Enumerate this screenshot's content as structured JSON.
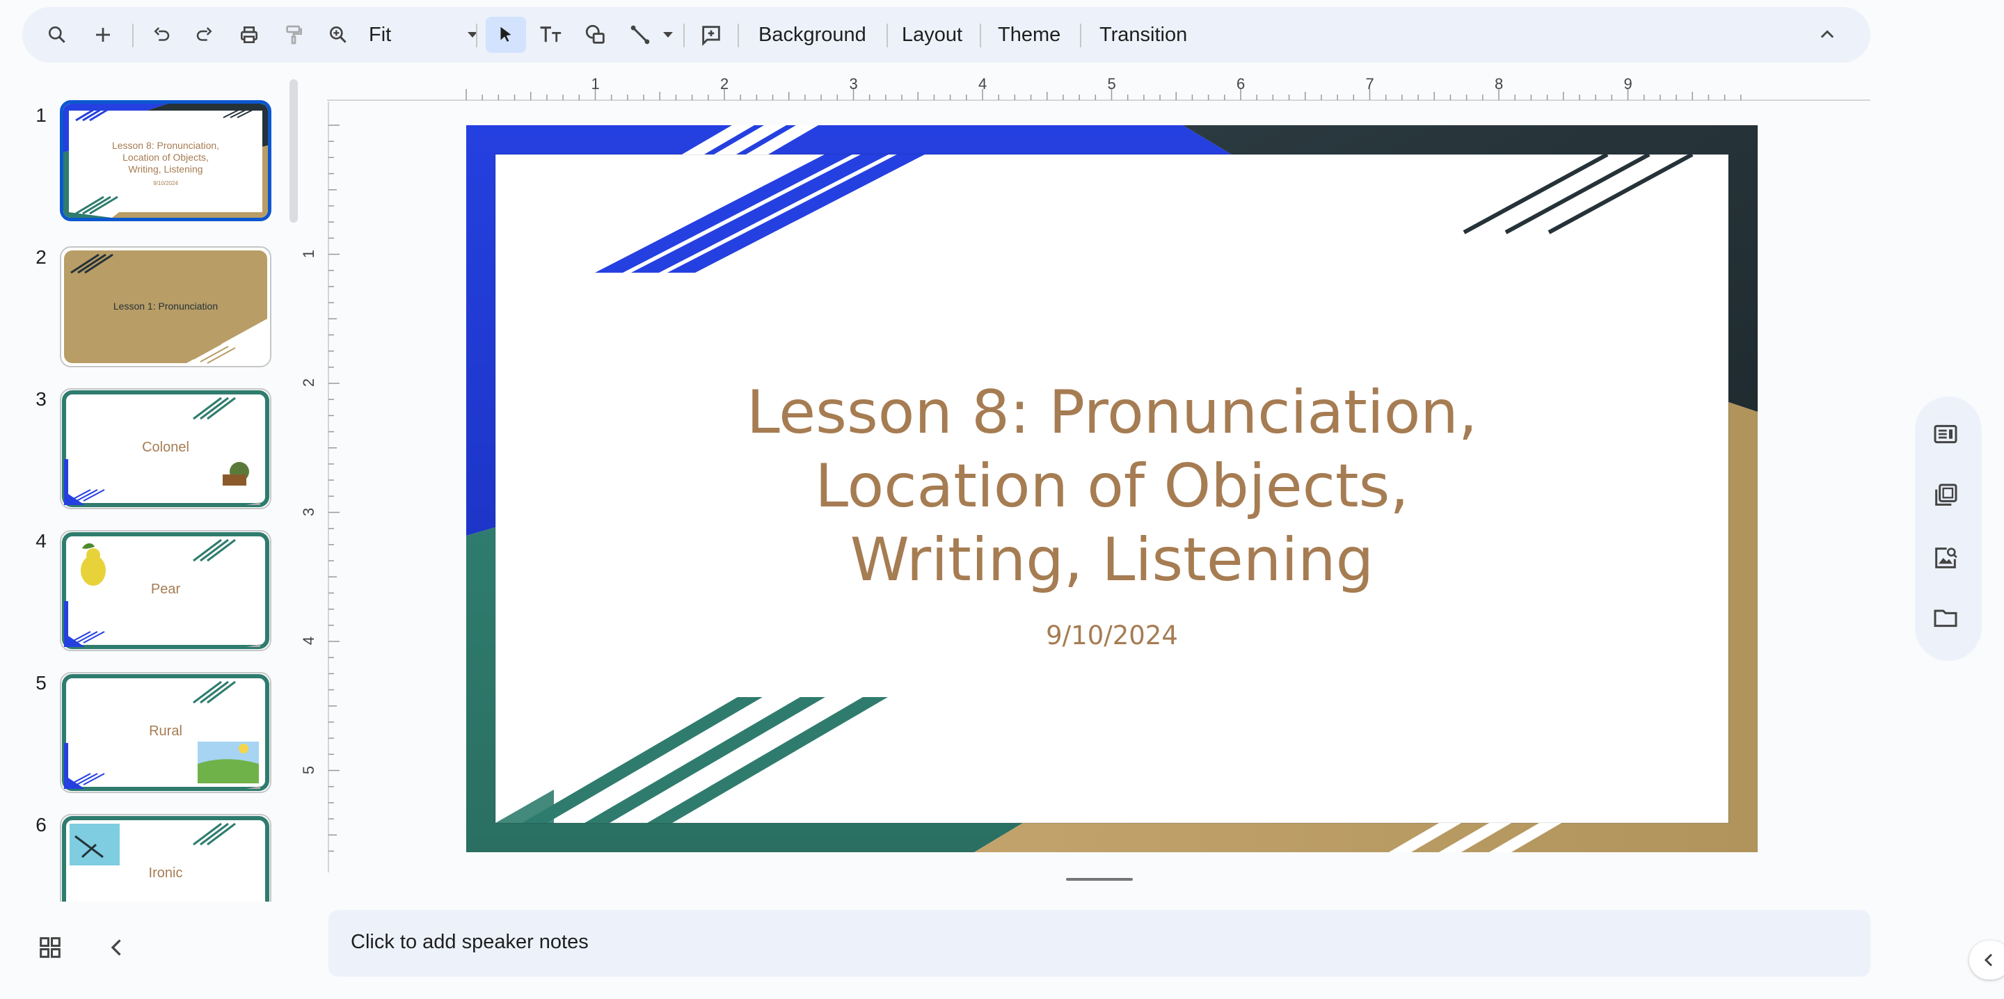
{
  "toolbar": {
    "zoom_value": "Fit",
    "background_label": "Background",
    "layout_label": "Layout",
    "theme_label": "Theme",
    "transition_label": "Transition",
    "icons": [
      "search-icon",
      "add-icon",
      "undo-icon",
      "redo-icon",
      "print-icon",
      "paint-format-icon",
      "zoom-icon",
      "select-icon",
      "text-box-icon",
      "shape-icon",
      "line-icon",
      "comment-icon",
      "collapse-icon"
    ]
  },
  "filmstrip": {
    "slides": [
      {
        "number": "1",
        "title": "Lesson 8: Pronunciation, Location of Objects, Writing, Listening",
        "subtitle": "9/10/2024"
      },
      {
        "number": "2",
        "title": "Lesson 1: Pronunciation"
      },
      {
        "number": "3",
        "title": "Colonel"
      },
      {
        "number": "4",
        "title": "Pear"
      },
      {
        "number": "5",
        "title": "Rural"
      },
      {
        "number": "6",
        "title": "Ironic"
      }
    ]
  },
  "ruler": {
    "horizontal": [
      "1",
      "2",
      "3",
      "4",
      "5",
      "6",
      "7",
      "8",
      "9"
    ],
    "vertical": [
      "1",
      "2",
      "3",
      "4",
      "5"
    ]
  },
  "slide": {
    "title_line1": "Lesson 8: Pronunciation,",
    "title_line2": "Location of Objects,",
    "title_line3": "Writing, Listening",
    "date": "9/10/2024",
    "colors": {
      "blue": "#2540e0",
      "dark": "#253238",
      "green": "#2f7c6e",
      "tan": "#b89d66",
      "title": "#a67c52"
    }
  },
  "notes": {
    "placeholder": "Click to add speaker notes"
  },
  "sidepanel": {
    "icons": [
      "speaker-notes-icon",
      "slides-library-icon",
      "image-search-icon",
      "folder-icon"
    ]
  },
  "bottom": {
    "icons": [
      "grid-view-icon",
      "collapse-filmstrip-icon",
      "expand-panel-icon"
    ]
  }
}
